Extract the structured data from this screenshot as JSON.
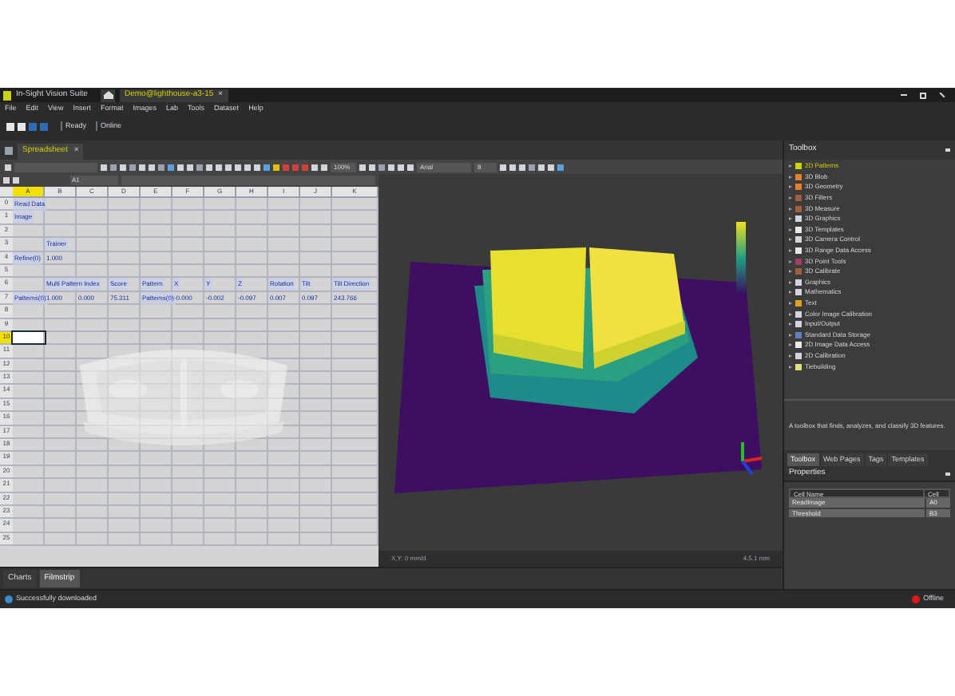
{
  "window": {
    "title": "In-Sight Vision Suite",
    "document_tab": "Demo@lighthouse-a3-15",
    "close": "×"
  },
  "menu": [
    "File",
    "Edit",
    "View",
    "Insert",
    "Format",
    "Images",
    "Lab",
    "Tools",
    "Dataset",
    "Help"
  ],
  "toolbar": {
    "status": "Ready",
    "mode": "Online"
  },
  "panel_tab": {
    "label": "Spreadsheet",
    "close": "×"
  },
  "view_toolbar": {
    "zoom": "100%",
    "font": "Arial",
    "size": "8"
  },
  "formula_bar": {
    "cell": "A1"
  },
  "spreadsheet": {
    "columns": [
      {
        "label": "A",
        "selected": true
      },
      {
        "label": "B",
        "selected": false
      },
      {
        "label": "C",
        "selected": false
      },
      {
        "label": "D",
        "selected": false
      },
      {
        "label": "E",
        "selected": false
      },
      {
        "label": "F",
        "selected": false
      },
      {
        "label": "G",
        "selected": false
      },
      {
        "label": "H",
        "selected": false
      },
      {
        "label": "I",
        "selected": false
      },
      {
        "label": "J",
        "selected": false
      },
      {
        "label": "K",
        "selected": false
      }
    ],
    "rows": [
      {
        "label": "0",
        "selected": false,
        "cells": [
          {
            "text": "Read Data",
            "kind": "label"
          }
        ]
      },
      {
        "label": "1",
        "selected": false,
        "cells": [
          {
            "text": "Image",
            "kind": "label"
          }
        ]
      },
      {
        "label": "2",
        "selected": false,
        "cells": []
      },
      {
        "label": "3",
        "selected": false,
        "cells": [
          {
            "text": ""
          },
          {
            "text": "Trainer",
            "kind": "label"
          }
        ]
      },
      {
        "label": "4",
        "selected": false,
        "cells": [
          {
            "text": "Refine(0)",
            "kind": "label"
          },
          {
            "text": "1.000",
            "kind": "value"
          }
        ]
      },
      {
        "label": "5",
        "selected": false,
        "cells": []
      },
      {
        "label": "6",
        "selected": false,
        "cells": [
          {
            "text": ""
          },
          {
            "text": "Multi Pattern Index",
            "kind": "label"
          },
          {
            "text": ""
          },
          {
            "text": "Score",
            "kind": "label"
          },
          {
            "text": "Pattern",
            "kind": "label"
          },
          {
            "text": "X",
            "kind": "label"
          },
          {
            "text": "Y",
            "kind": "label"
          },
          {
            "text": "Z",
            "kind": "label"
          },
          {
            "text": "Rotation",
            "kind": "label"
          },
          {
            "text": "Tilt",
            "kind": "label"
          },
          {
            "text": "Tilt Direction",
            "kind": "label"
          }
        ]
      },
      {
        "label": "7",
        "selected": false,
        "cells": [
          {
            "text": "Patterns(0)",
            "kind": "label"
          },
          {
            "text": "1.000",
            "kind": "value"
          },
          {
            "text": "0.000",
            "kind": "value"
          },
          {
            "text": "75.311",
            "kind": "value"
          },
          {
            "text": "Patterns(0)",
            "kind": "label"
          },
          {
            "text": "-0.000",
            "kind": "value"
          },
          {
            "text": "-0.002",
            "kind": "value"
          },
          {
            "text": "-0.097",
            "kind": "value"
          },
          {
            "text": "0.007",
            "kind": "value"
          },
          {
            "text": "0.097",
            "kind": "value"
          },
          {
            "text": "243.766",
            "kind": "value"
          }
        ]
      },
      {
        "label": "8",
        "selected": false,
        "cells": []
      },
      {
        "label": "9",
        "selected": false,
        "cells": []
      },
      {
        "label": "10",
        "selected": true,
        "cells": []
      },
      {
        "label": "11",
        "selected": false,
        "cells": []
      },
      {
        "label": "12",
        "selected": false,
        "cells": []
      },
      {
        "label": "13",
        "selected": false,
        "cells": []
      },
      {
        "label": "14",
        "selected": false,
        "cells": []
      },
      {
        "label": "15",
        "selected": false,
        "cells": []
      },
      {
        "label": "16",
        "selected": false,
        "cells": []
      },
      {
        "label": "17",
        "selected": false,
        "cells": []
      },
      {
        "label": "18",
        "selected": false,
        "cells": []
      },
      {
        "label": "19",
        "selected": false,
        "cells": []
      },
      {
        "label": "20",
        "selected": false,
        "cells": []
      },
      {
        "label": "21",
        "selected": false,
        "cells": []
      },
      {
        "label": "22",
        "selected": false,
        "cells": []
      },
      {
        "label": "23",
        "selected": false,
        "cells": []
      },
      {
        "label": "24",
        "selected": false,
        "cells": []
      },
      {
        "label": "25",
        "selected": false,
        "cells": []
      }
    ]
  },
  "view_status": {
    "left": "X,Y: 0 mm/d",
    "right": "4.5.1 mm"
  },
  "toolbox": {
    "title": "Toolbox",
    "items": [
      {
        "label": "2D Patterns",
        "selected": true
      },
      {
        "label": "3D Blob",
        "selected": false
      },
      {
        "label": "3D Geometry",
        "selected": false
      },
      {
        "label": "3D Filters",
        "selected": false
      },
      {
        "label": "3D Measure",
        "selected": false
      },
      {
        "label": "3D Graphics",
        "selected": false
      },
      {
        "label": "3D Templates",
        "selected": false
      },
      {
        "label": "3D Camera Control",
        "selected": false
      },
      {
        "label": "3D Range Data Access",
        "selected": false
      },
      {
        "label": "3D Point Tools",
        "selected": false
      },
      {
        "label": "3D Calibrate",
        "selected": false
      },
      {
        "label": "Graphics",
        "selected": false
      },
      {
        "label": "Mathematics",
        "selected": false
      },
      {
        "label": "Text",
        "selected": false
      },
      {
        "label": "Color Image Calibration",
        "selected": false
      },
      {
        "label": "Input/Output",
        "selected": false
      },
      {
        "label": "Standard Data Storage",
        "selected": false
      },
      {
        "label": "2D Image Data Access",
        "selected": false
      },
      {
        "label": "2D Calibration",
        "selected": false
      },
      {
        "label": "Tiebuilding",
        "selected": false
      }
    ],
    "description": "A toolbox that finds, analyzes, and classify 3D features."
  },
  "right_tabs": [
    {
      "label": "Toolbox",
      "selected": true
    },
    {
      "label": "Web Pages",
      "selected": false
    },
    {
      "label": "Tags",
      "selected": false
    },
    {
      "label": "Templates",
      "selected": false
    }
  ],
  "properties": {
    "title": "Properties",
    "columns": [
      "Cell Name",
      "Cell"
    ],
    "rows": [
      [
        "ReadImage",
        "A0"
      ],
      [
        "Threshold",
        "B3"
      ]
    ]
  },
  "bottom_tabs": [
    {
      "label": "Charts",
      "selected": false
    },
    {
      "label": "Filmstrip",
      "selected": true
    }
  ],
  "status_bar": {
    "message": "Successfully downloaded",
    "connection": "Offline"
  }
}
